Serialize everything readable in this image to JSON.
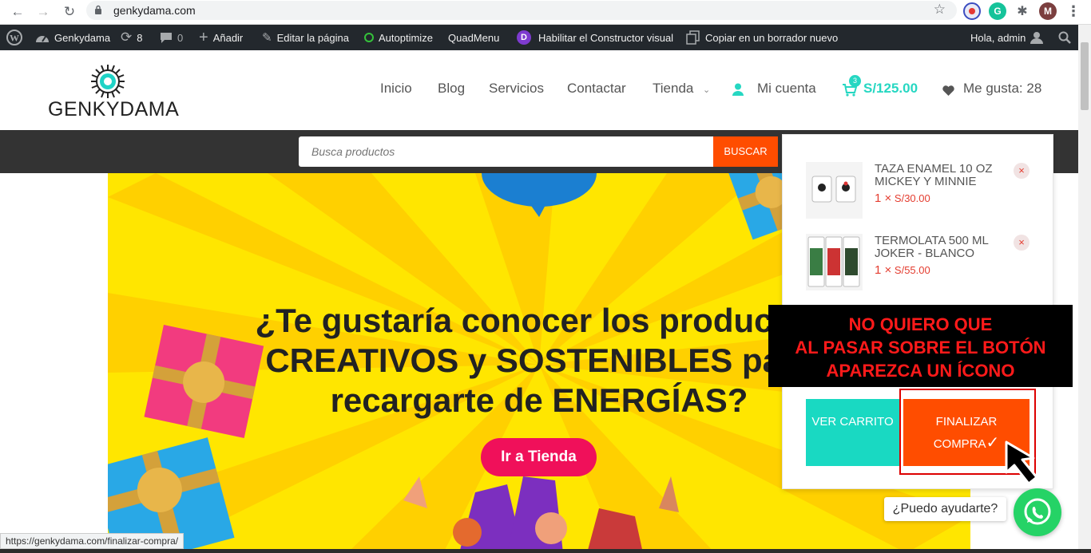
{
  "browser": {
    "url": "genkydama.com",
    "profile_initial": "M",
    "extension_initial": "G"
  },
  "admin_bar": {
    "site_name": "Genkydama",
    "updates_count": "8",
    "comments_count": "0",
    "add_label": "Añadir",
    "edit_label": "Editar la página",
    "autoptimize_label": "Autoptimize",
    "quadmenu_label": "QuadMenu",
    "builder_label": "Habilitar el Constructor visual",
    "builder_icon_letter": "D",
    "copy_label": "Copiar en un borrador nuevo",
    "greeting": "Hola, admin"
  },
  "site": {
    "logo_text": "GENKYDAMA",
    "menu": [
      {
        "label": "Inicio"
      },
      {
        "label": "Blog"
      },
      {
        "label": "Servicios"
      },
      {
        "label": "Contactar"
      },
      {
        "label": "Tienda"
      }
    ],
    "account_label": "Mi cuenta",
    "cart_total": "S/125.00",
    "cart_count": "3",
    "likes_label": "Me gusta: 28"
  },
  "search": {
    "placeholder": "Busca productos",
    "button_label": "BUSCAR"
  },
  "hero": {
    "title_line1": "¿Te gustaría conocer los productos",
    "title_line2": "CREATIVOS y SOSTENIBLES para",
    "title_line3": "recargarte de ENERGÍAS?",
    "button_label": "Ir a Tienda"
  },
  "cart": {
    "items": [
      {
        "name": "TAZA ENAMEL 10 OZ MICKEY Y MINNIE",
        "qty": "1 ×",
        "price": "S/30.00"
      },
      {
        "name": "TERMOLATA 500 ML JOKER - BLANCO",
        "qty": "1 ×",
        "price": "S/55.00"
      }
    ],
    "remove_symbol": "×",
    "view_cart_label": "VER CARRITO",
    "checkout_label": "FINALIZAR COMPRA",
    "checkout_icon": "✓"
  },
  "annotation": {
    "line1": "NO QUIERO QUE",
    "line2": "AL PASAR SOBRE EL BOTÓN",
    "line3": "APAREZCA UN ÍCONO"
  },
  "whatsapp": {
    "bubble_text": "¿Puedo ayudarte?"
  },
  "status_bar": {
    "link_url": "https://genkydama.com/finalizar-compra/"
  },
  "colors": {
    "accent_teal": "#26d7c2",
    "accent_orange": "#ff4d00",
    "hero_yellow": "#ffe600",
    "cta_pink": "#f0105a",
    "whatsapp_green": "#25d366"
  }
}
